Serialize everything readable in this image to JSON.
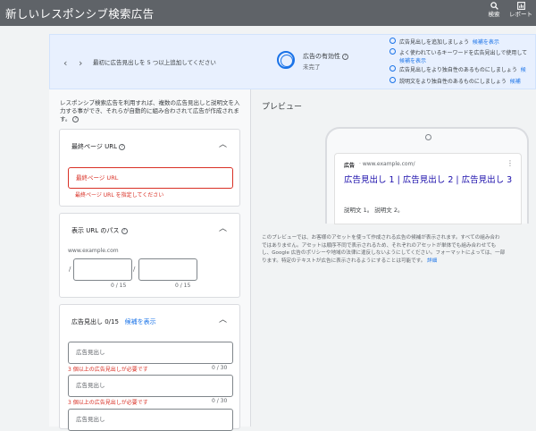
{
  "header": {
    "title": "新しいレスポンシブ検索広告",
    "search_label": "検索",
    "report_label": "レポート"
  },
  "banner": {
    "prev_icon": "chevron-left-icon",
    "next_icon": "chevron-right-icon",
    "suggestion": "最初に広告見出しを 5 つ以上追加してください",
    "strength_label": "広告の有効性",
    "strength_value": "未完了",
    "tips": [
      {
        "text": "広告見出しを追加しましょう",
        "link": "候補を表示"
      },
      {
        "text": "よく使われているキーワードを広告見出しで使用して",
        "link": "候補を表示"
      },
      {
        "text": "広告見出しをより独自性のあるものにしましょう",
        "link": "候"
      },
      {
        "text": "説明文をより独自性のあるものにしましょう",
        "link": "候補"
      }
    ]
  },
  "left": {
    "intro": "レスポンシブ検索広告を利用すれば、複数の広告見出しと説明文を入力する事ができ、それらが自動的に組み合わされて広告が作成されます。",
    "final_url": {
      "title": "最終ページ URL",
      "placeholder": "最終ページ URL",
      "error": "最終ページ URL を指定してください"
    },
    "display_path": {
      "title": "表示 URL のパス",
      "domain": "www.example.com",
      "sep": "/",
      "counter1": "0 / 15",
      "counter2": "0 / 15"
    },
    "headlines": {
      "title": "広告見出し 0/15",
      "link": "候補を表示",
      "placeholder": "広告見出し",
      "error": "3 個以上の広告見出しが必要です",
      "counter": "0 / 30"
    }
  },
  "preview": {
    "title": "プレビュー",
    "ad_label": "広告",
    "ad_url": "· www.example.com/",
    "headline": "広告見出し 1 | 広告見出し 2 | 広告見出し 3",
    "description": "説明文 1。 説明文 2。",
    "disclaimer_lines": [
      "このプレビューでは、お客様のアセットを使って作成される広告の候補が表示されます。すべての組み合わ",
      "ではありません。アセットは順序不同で表示されるため、それぞれのアセットが単体でも組み合わせても",
      "し、Google 広告のポリシーや地域の法律に違反しないようにしてください。フォーマットによっては、一部",
      "ります。特定のテキストが広告に表示されるようにすることは可能です。"
    ],
    "disclaimer_link": "詳細"
  }
}
